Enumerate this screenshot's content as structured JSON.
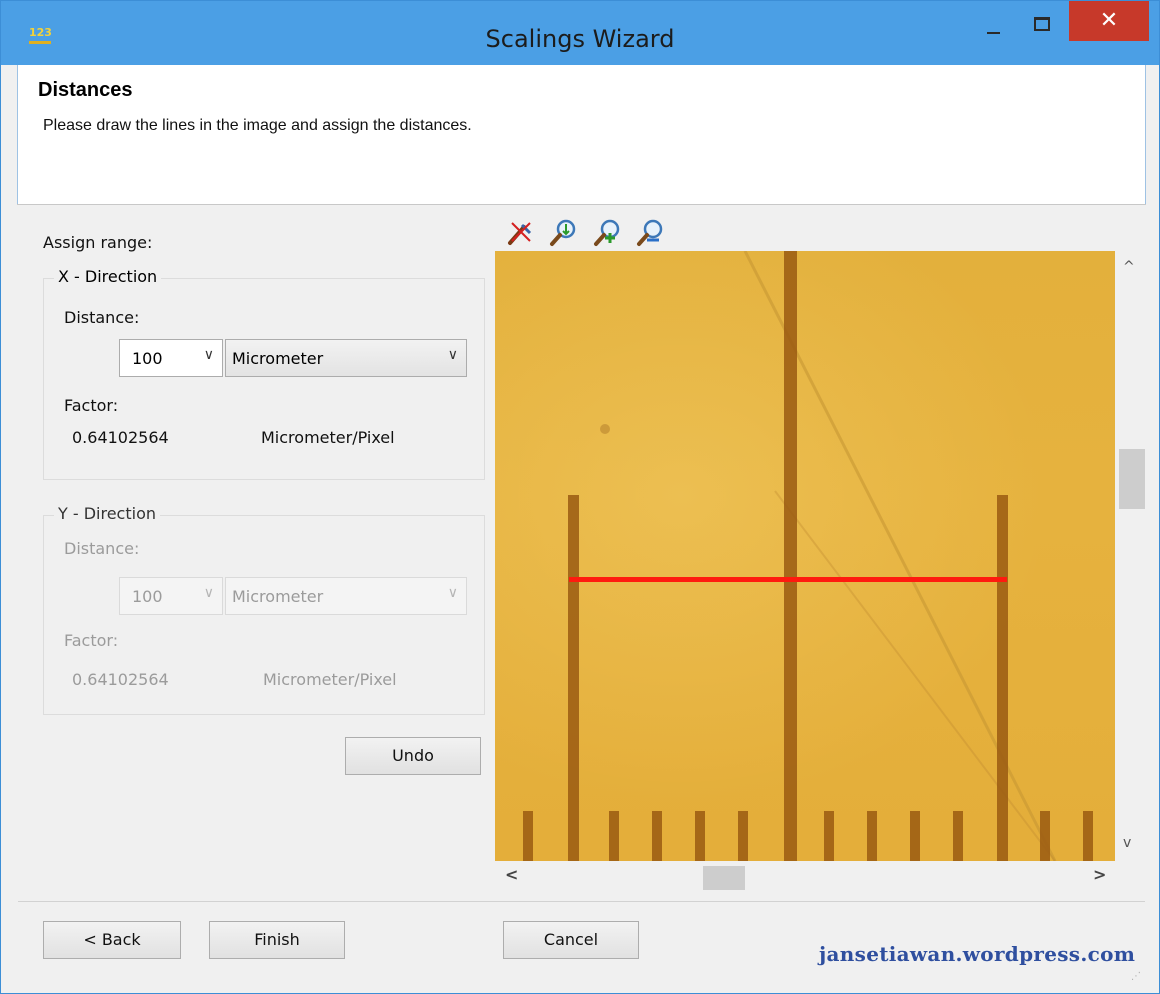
{
  "window": {
    "title": "Scalings Wizard",
    "app_icon_text": "123",
    "close_glyph": "✕",
    "accent_color": "#4b9fe5"
  },
  "header": {
    "title": "Distances",
    "description": "Please draw the lines in the image and assign the distances."
  },
  "assign": {
    "label": "Assign range:",
    "x": {
      "legend": "X - Direction",
      "distance_label": "Distance:",
      "distance_value": "100",
      "unit": "Micrometer",
      "factor_label": "Factor:",
      "factor_value": "0.64102564",
      "factor_unit": "Micrometer/Pixel"
    },
    "y": {
      "legend": "Y - Direction",
      "distance_label": "Distance:",
      "distance_value": "100",
      "unit": "Micrometer",
      "factor_label": "Factor:",
      "factor_value": "0.64102564",
      "factor_unit": "Micrometer/Pixel",
      "enabled": false
    },
    "undo_label": "Undo"
  },
  "toolbar": {
    "icons": [
      "clear-line-icon",
      "zoom-fit-icon",
      "zoom-in-icon",
      "zoom-out-icon"
    ]
  },
  "image": {
    "background_color": "#e4b03c",
    "measure_line_color": "#ff1a0f"
  },
  "scroll": {
    "up": "^",
    "down": "v",
    "left": "<",
    "right": ">"
  },
  "footer": {
    "back_label": "< Back",
    "finish_label": "Finish",
    "cancel_label": "Cancel",
    "watermark": "jansetiawan.wordpress.com"
  }
}
